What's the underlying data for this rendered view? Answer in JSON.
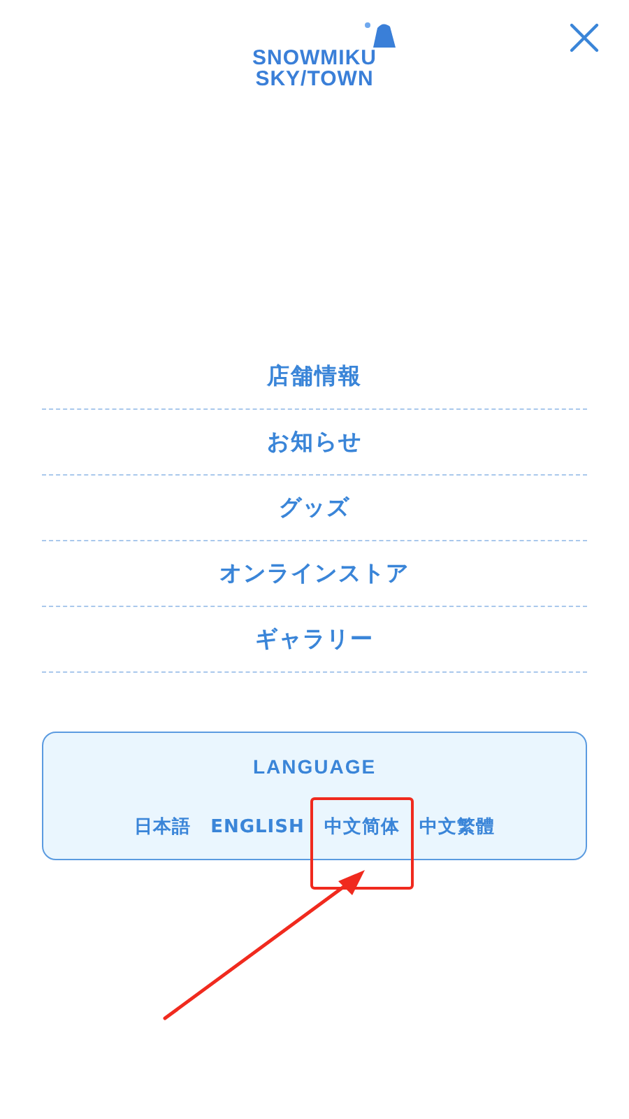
{
  "logo": {
    "line_1": "SNOWMIKU",
    "line_2": "SKY/TOWN"
  },
  "menu": [
    {
      "label": "店舗情報"
    },
    {
      "label": "お知らせ"
    },
    {
      "label": "グッズ"
    },
    {
      "label": "オンラインストア"
    },
    {
      "label": "ギャラリー"
    }
  ],
  "language": {
    "title": "LANGUAGE",
    "options": [
      {
        "label": "日本語",
        "highlighted": false
      },
      {
        "label": "ENGLISH",
        "highlighted": false
      },
      {
        "label": "中文简体",
        "highlighted": true
      },
      {
        "label": "中文繁體",
        "highlighted": false
      }
    ]
  }
}
